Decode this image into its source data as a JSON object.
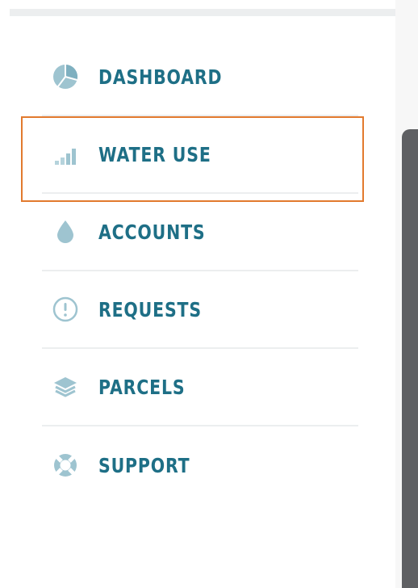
{
  "nav": {
    "items": [
      {
        "label": "DASHBOARD",
        "icon": "pie-chart-icon"
      },
      {
        "label": "WATER USE",
        "icon": "bar-chart-icon"
      },
      {
        "label": "ACCOUNTS",
        "icon": "water-drop-icon"
      },
      {
        "label": "REQUESTS",
        "icon": "alert-circle-icon"
      },
      {
        "label": "PARCELS",
        "icon": "layers-icon"
      },
      {
        "label": "SUPPORT",
        "icon": "lifebuoy-icon"
      }
    ],
    "highlighted_item": "WATER USE"
  },
  "colors": {
    "label": "#1e6f86",
    "icon": "#9ec4d0",
    "highlight_border": "#e27a2e",
    "scrollbar_thumb": "#5f6063"
  }
}
